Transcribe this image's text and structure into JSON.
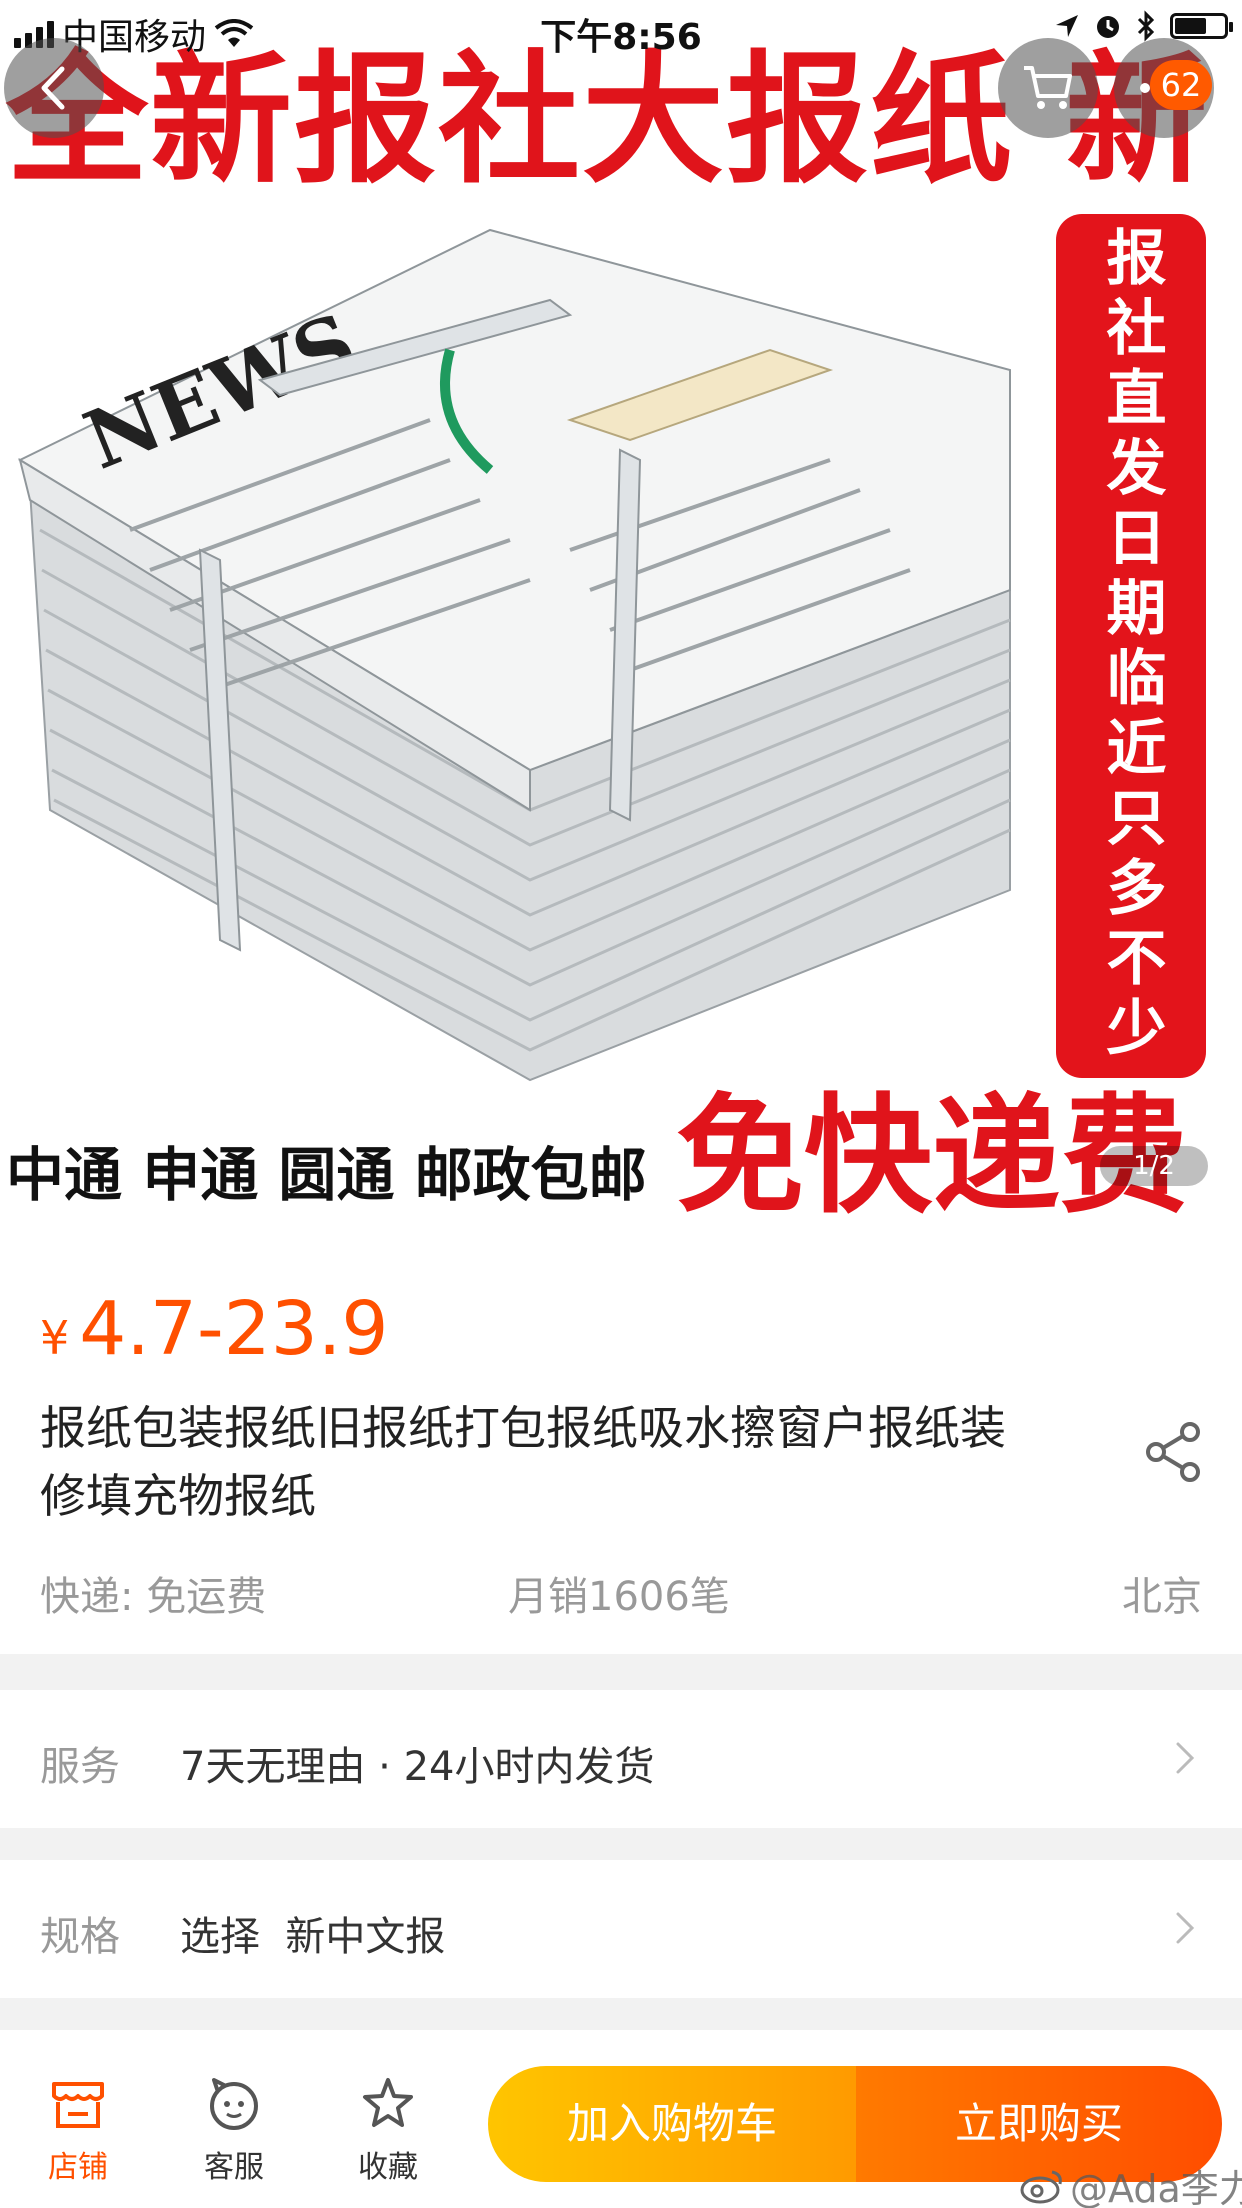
{
  "status_bar": {
    "carrier": "中国移动",
    "time": "下午8:56"
  },
  "nav": {
    "cart_badge": "62"
  },
  "hero": {
    "banner_text": "全新报社大报纸 新",
    "side_text": "报社直发日期临近只多不少",
    "bottom_left_text": "中通 申通 圆通 邮政包邮",
    "bottom_right_text": "免快递费",
    "pager": "1/2"
  },
  "product": {
    "price_symbol": "¥",
    "price_range": "4.7-23.9",
    "title": "报纸包装报纸旧报纸打包报纸吸水擦窗户报纸装修填充物报纸",
    "shipping": "快递: 免运费",
    "sales": "月销1606笔",
    "location": "北京"
  },
  "options": {
    "service_label": "服务",
    "service_value": "7天无理由 · 24小时内发货",
    "spec_label": "规格",
    "spec_value": "选择  新中文报"
  },
  "bottom_bar": {
    "store_label": "店铺",
    "service_label": "客服",
    "fav_label": "收藏",
    "add_to_cart": "加入购物车",
    "buy_now": "立即购买"
  },
  "watermark": "@Ada李力",
  "colors": {
    "accent": "#ff5000",
    "banner_red": "#e0141b",
    "cart_button": "#ffb400",
    "buy_button": "#ff5a00"
  }
}
